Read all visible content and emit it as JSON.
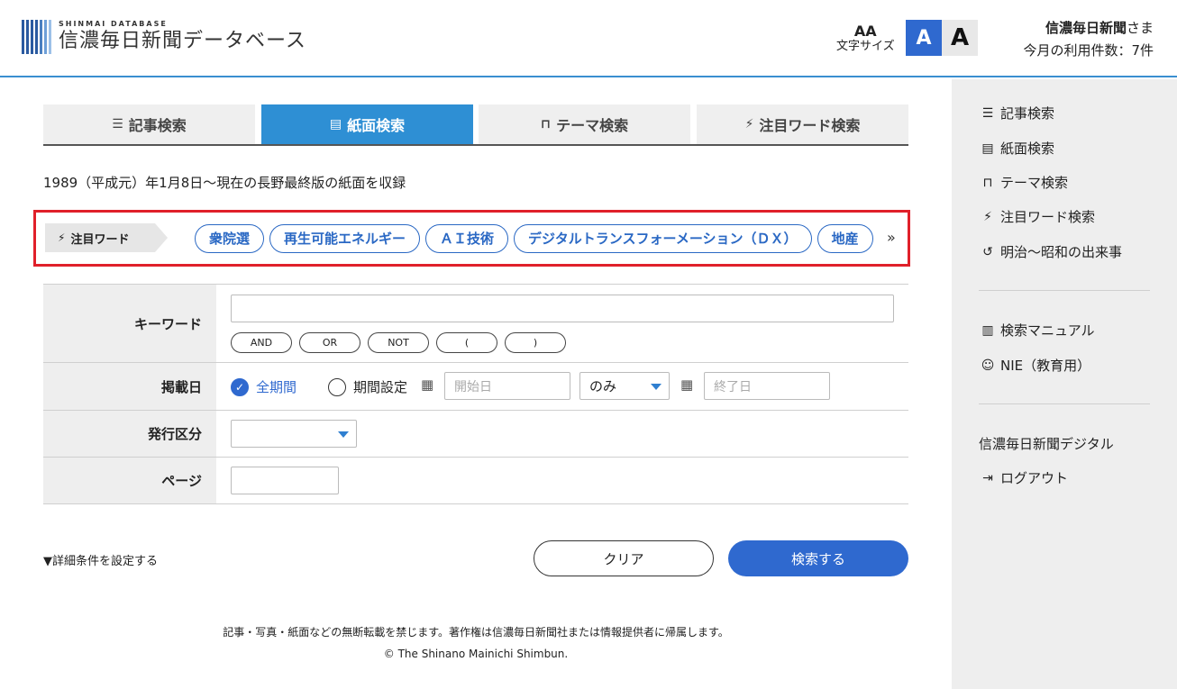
{
  "header": {
    "logo_sub": "SHINMAI DATABASE",
    "logo_main": "信濃毎日新聞データベース",
    "font_size_icon": "AA",
    "font_size_label": "文字サイズ",
    "font_small": "A",
    "font_large": "A",
    "user_name": "信濃毎日新聞",
    "user_suffix": "さま",
    "usage": "今月の利用件数：7件"
  },
  "tabs": [
    {
      "label": "記事検索",
      "icon": "list-icon"
    },
    {
      "label": "紙面検索",
      "icon": "newspaper-icon"
    },
    {
      "label": "テーマ検索",
      "icon": "bookmark-icon"
    },
    {
      "label": "注目ワード検索",
      "icon": "bolt-icon"
    }
  ],
  "range_text": "1989（平成元）年1月8日～現在の長野最終版の紙面を収録",
  "hot_words": {
    "label": "注目ワード",
    "chips": [
      "衆院選",
      "再生可能エネルギー",
      "ＡＩ技術",
      "デジタルトランスフォーメーション（ＤＸ）",
      "地産"
    ],
    "more": "»"
  },
  "form": {
    "keyword_label": "キーワード",
    "ops": [
      "AND",
      "OR",
      "NOT",
      "(",
      ")"
    ],
    "date_label": "掲載日",
    "all_period": "全期間",
    "period_setting": "期間設定",
    "start_placeholder": "開始日",
    "mode_selected": "のみ",
    "end_placeholder": "終了日",
    "issue_label": "発行区分",
    "page_label": "ページ"
  },
  "advanced": "▼詳細条件を設定する",
  "buttons": {
    "clear": "クリア",
    "search": "検索する"
  },
  "sidebar": {
    "items": [
      {
        "label": "記事検索",
        "icon": "list-icon"
      },
      {
        "label": "紙面検索",
        "icon": "newspaper-icon"
      },
      {
        "label": "テーマ検索",
        "icon": "bookmark-icon"
      },
      {
        "label": "注目ワード検索",
        "icon": "bolt-icon"
      },
      {
        "label": "明治～昭和の出来事",
        "icon": "history-icon"
      }
    ],
    "manual": "検索マニュアル",
    "nie": "NIE（教育用）",
    "digital": "信濃毎日新聞デジタル",
    "logout": "ログアウト"
  },
  "footer": {
    "note": "記事・写真・紙面などの無断転載を禁じます。著作権は信濃毎日新聞社または情報提供者に帰属します。",
    "copyright": "© The Shinano Mainichi Shimbun."
  },
  "colors": {
    "accent": "#2f69cf",
    "tab_active": "#2e8fd4",
    "highlight_border": "#e0202a"
  }
}
